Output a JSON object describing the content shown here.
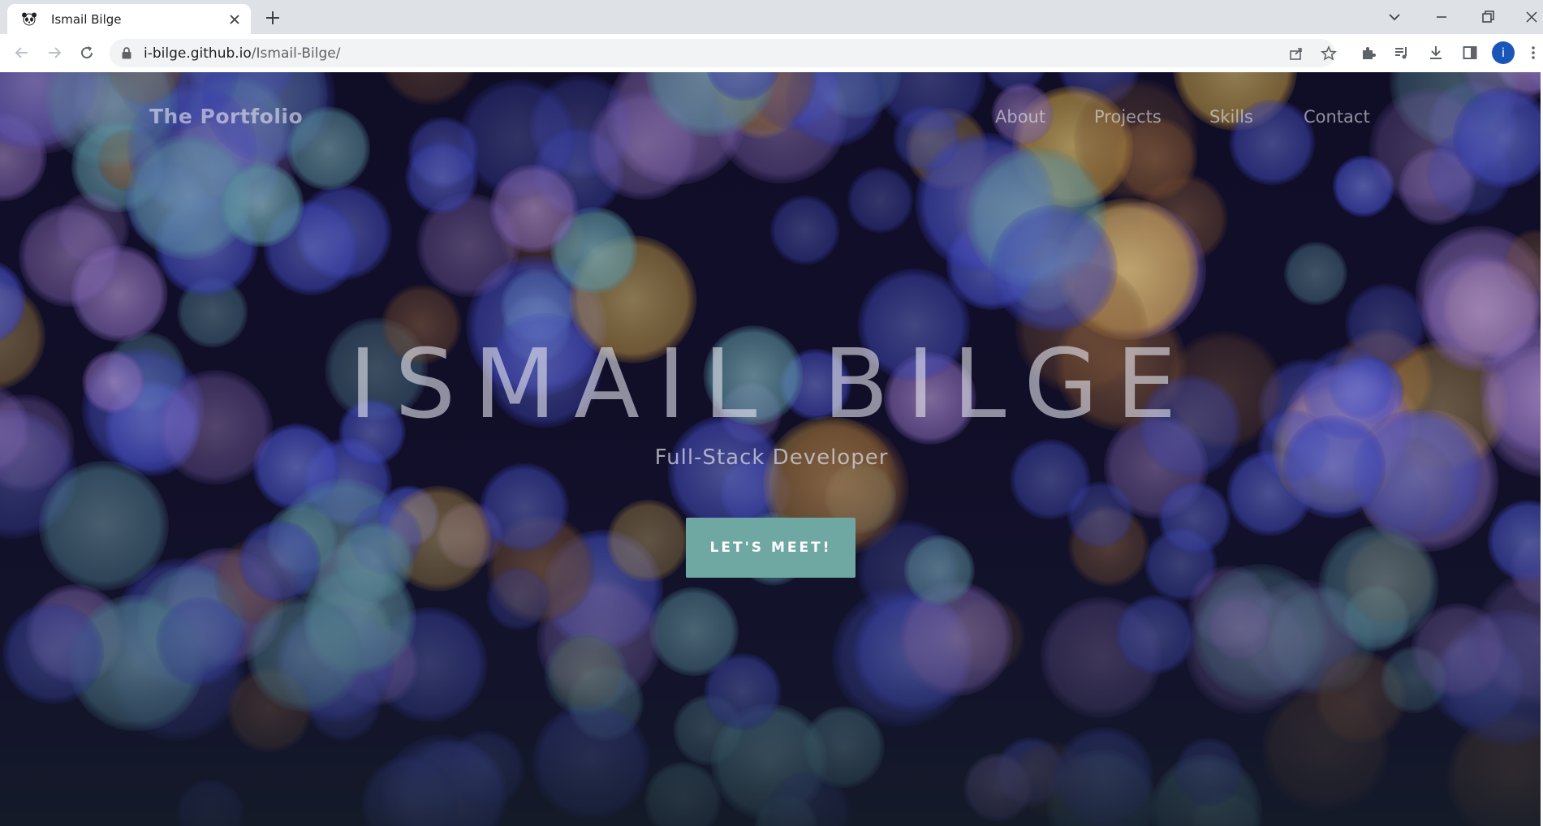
{
  "browser": {
    "tab_title": "Ismail Bilge",
    "url_host": "i-bilge.github.io",
    "url_path": "/Ismail-Bilge/",
    "profile_initial": "i"
  },
  "site": {
    "brand": "The Portfolio",
    "nav": [
      "About",
      "Projects",
      "Skills",
      "Contact"
    ],
    "hero_title": "ISMAIL BILGE",
    "hero_subtitle": "Full-Stack Developer",
    "cta_label": "LET'S MEET!"
  },
  "colors": {
    "cta": "#6fa7a3",
    "tab_strip": "#dee1e6",
    "omnibox": "#f1f3f4",
    "avatar": "#1a56b8"
  }
}
